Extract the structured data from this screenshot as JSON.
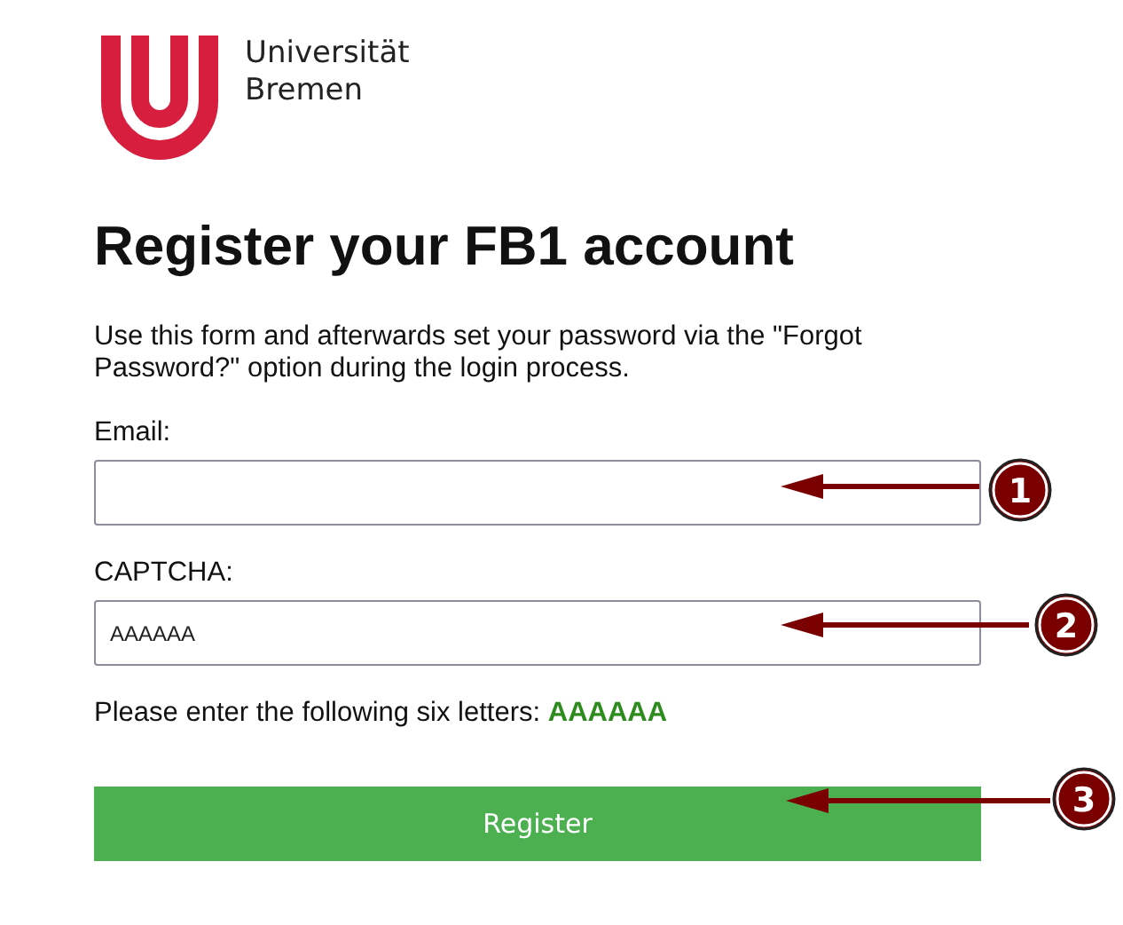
{
  "logo": {
    "lines": [
      "Universität",
      "Bremen"
    ]
  },
  "heading": "Register your FB1 account",
  "intro": "Use this form and afterwards set your password via the \"Forgot Password?\" option during the login process.",
  "fields": [
    {
      "label": "Email:"
    },
    {
      "label": "CAPTCHA:",
      "value": "AAAAAA"
    }
  ],
  "hint": "Please enter the following six letters: **AAAAAA**",
  "button": "Register",
  "annotations": [
    {
      "number": "1"
    },
    {
      "number": "2"
    },
    {
      "number": "3"
    }
  ]
}
